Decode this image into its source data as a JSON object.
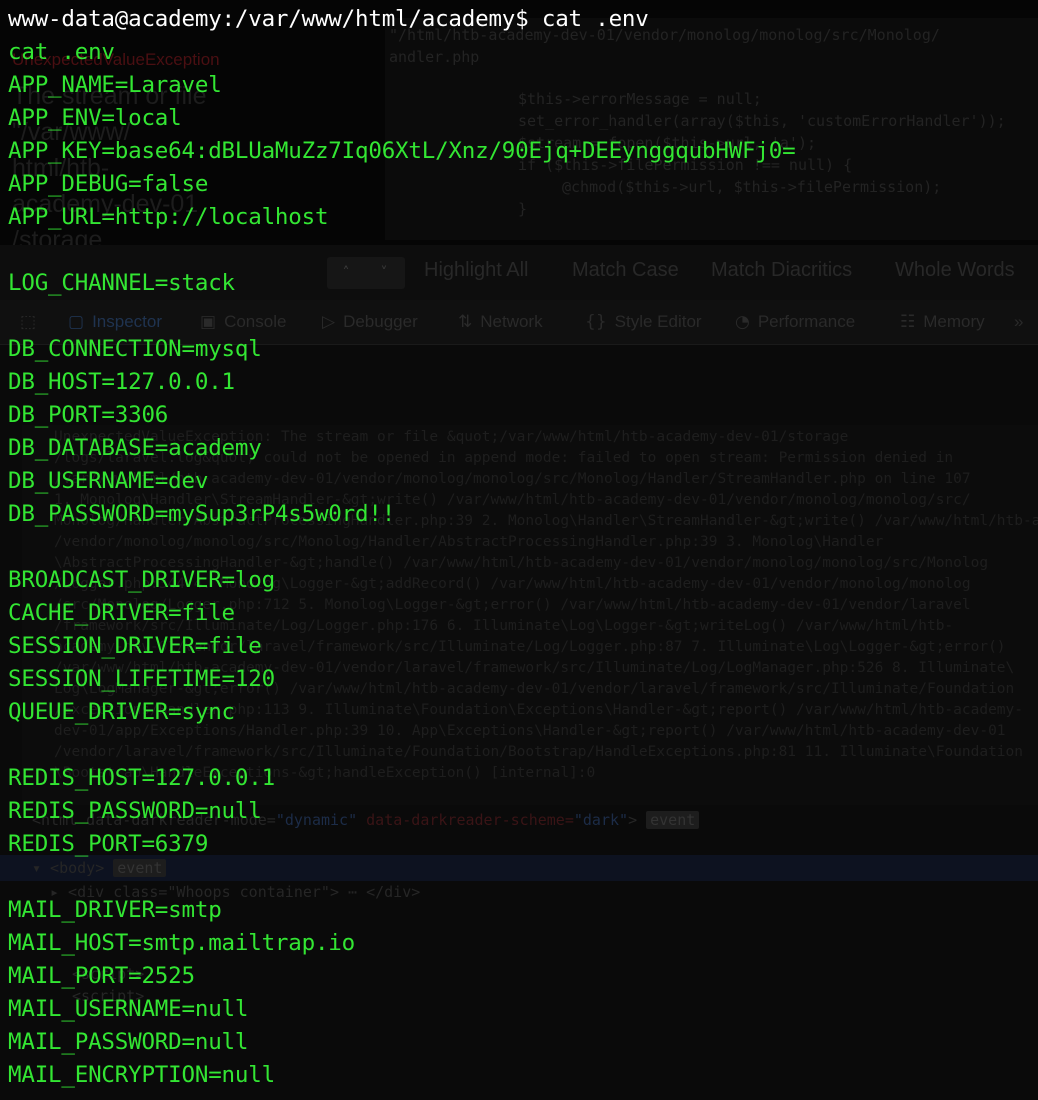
{
  "terminal": {
    "prompt": "www-data@academy:/var/www/html/academy$ cat .env",
    "echo": "cat .env",
    "lines": [
      "APP_NAME=Laravel",
      "APP_ENV=local",
      "APP_KEY=base64:dBLUaMuZz7Iq06XtL/Xnz/90Ejq+DEEynggqubHWFj0=",
      "APP_DEBUG=false",
      "APP_URL=http://localhost",
      "",
      "LOG_CHANNEL=stack",
      "",
      "DB_CONNECTION=mysql",
      "DB_HOST=127.0.0.1",
      "DB_PORT=3306",
      "DB_DATABASE=academy",
      "DB_USERNAME=dev",
      "DB_PASSWORD=mySup3rP4s5w0rd!!",
      "",
      "BROADCAST_DRIVER=log",
      "CACHE_DRIVER=file",
      "SESSION_DRIVER=file",
      "SESSION_LIFETIME=120",
      "QUEUE_DRIVER=sync",
      "",
      "REDIS_HOST=127.0.0.1",
      "REDIS_PASSWORD=null",
      "REDIS_PORT=6379",
      "",
      "MAIL_DRIVER=smtp",
      "MAIL_HOST=smtp.mailtrap.io",
      "MAIL_PORT=2525",
      "MAIL_USERNAME=null",
      "MAIL_PASSWORD=null",
      "MAIL_ENCRYPTION=null"
    ],
    "text_color": "#33e633",
    "prompt_color": "#ffffff"
  },
  "background": {
    "error_tag": "UnexpectedValueException",
    "error_lines": [
      "The stream or file",
      "\"/var/www/",
      "html/htb-",
      "academy-dev-01",
      "/storage"
    ],
    "code_lines": [
      "\"/html/htb-academy-dev-01/vendor/monolog/monolog/src/Monolog/",
      "andler.php",
      "$this->errorMessage = null;",
      "set_error_handler(array($this, 'customErrorHandler'));",
      "$stream = fopen($this->url, 'a');",
      "if ($this->filePermission !== null) {",
      "@chmod($this->url, $this->filePermission);",
      "}"
    ],
    "findbar": {
      "up_icon": "chevron-up-icon",
      "down_icon": "chevron-down-icon",
      "options": [
        "Highlight All",
        "Match Case",
        "Match Diacritics",
        "Whole Words"
      ]
    },
    "devtools_tabs": [
      {
        "label": "Inspector",
        "icon": "inspector-icon"
      },
      {
        "label": "Console",
        "icon": "console-icon"
      },
      {
        "label": "Debugger",
        "icon": "debugger-icon"
      },
      {
        "label": "Network",
        "icon": "network-icon"
      },
      {
        "label": "Style Editor",
        "icon": "style-editor-icon"
      },
      {
        "label": "Performance",
        "icon": "performance-icon"
      },
      {
        "label": "Memory",
        "icon": "memory-icon"
      }
    ],
    "trace_lines": [
      "UnexpectedValueException: The stream or file &quot;/var/www/html/htb-academy-dev-01/storage",
      "/logs/laravel.log&quot; could not be opened in append mode: failed to open stream: Permission denied in",
      "/var/www/html/htb-academy-dev-01/vendor/monolog/monolog/src/Monolog/Handler/StreamHandler.php on line 107",
      "1. Monolog\\Handler\\StreamHandler-&gt;write() /var/www/html/htb-academy-dev-01/vendor/monolog/monolog/src/",
      "Monolog/Handler/AbstractProcessingHandler.php:39 2. Monolog\\Handler\\StreamHandler-&gt;write() /var/www/html/htb-academy-",
      "/vendor/monolog/monolog/src/Monolog/Handler/AbstractProcessingHandler.php:39 3. Monolog\\Handler",
      "\\AbstractProcessingHandler-&gt;handle() /var/www/html/htb-academy-dev-01/vendor/monolog/monolog/src/Monolog",
      "/Logger.php:344 4. Monolog\\Logger-&gt;addRecord() /var/www/html/htb-academy-dev-01/vendor/monolog/monolog",
      "/src/Monolog/Logger.php:712 5. Monolog\\Logger-&gt;error() /var/www/html/htb-academy-dev-01/vendor/laravel",
      "/framework/src/Illuminate/Log/Logger.php:176 6. Illuminate\\Log\\Logger-&gt;writeLog() /var/www/html/htb-",
      "academy-dev-01/vendor/laravel/framework/src/Illuminate/Log/Logger.php:87 7. Illuminate\\Log\\Logger-&gt;error()",
      "/var/www/html/htb-academy-dev-01/vendor/laravel/framework/src/Illuminate/Log/LogManager.php:526 8. Illuminate\\",
      "Log\\LogManager-&gt;error() /var/www/html/htb-academy-dev-01/vendor/laravel/framework/src/Illuminate/Foundation",
      "/Exceptions/Handler.php:113 9. Illuminate\\Foundation\\Exceptions\\Handler-&gt;report() /var/www/html/htb-academy-",
      "dev-01/app/Exceptions/Handler.php:39 10. App\\Exceptions\\Handler-&gt;report() /var/www/html/htb-academy-dev-01",
      "/vendor/laravel/framework/src/Illuminate/Foundation/Bootstrap/HandleExceptions.php:81 11. Illuminate\\Foundation",
      "\\Bootstrap\\HandleExceptions-&gt;handleException() [internal]:0"
    ],
    "dom": {
      "html_open": "<html data-darkreader-mode=",
      "html_mode": "\"dynamic\"",
      "html_scheme_attr": " data-darkreader-scheme=",
      "html_scheme": "\"dark\"",
      "html_close": ">",
      "html_badge": "event",
      "body": "▾ <body>",
      "body_badge": "event",
      "div": "▸ <div class=\"Whoops container\"> ⋯ </div>",
      "script1": "<script>",
      "script2": "<script>"
    }
  }
}
